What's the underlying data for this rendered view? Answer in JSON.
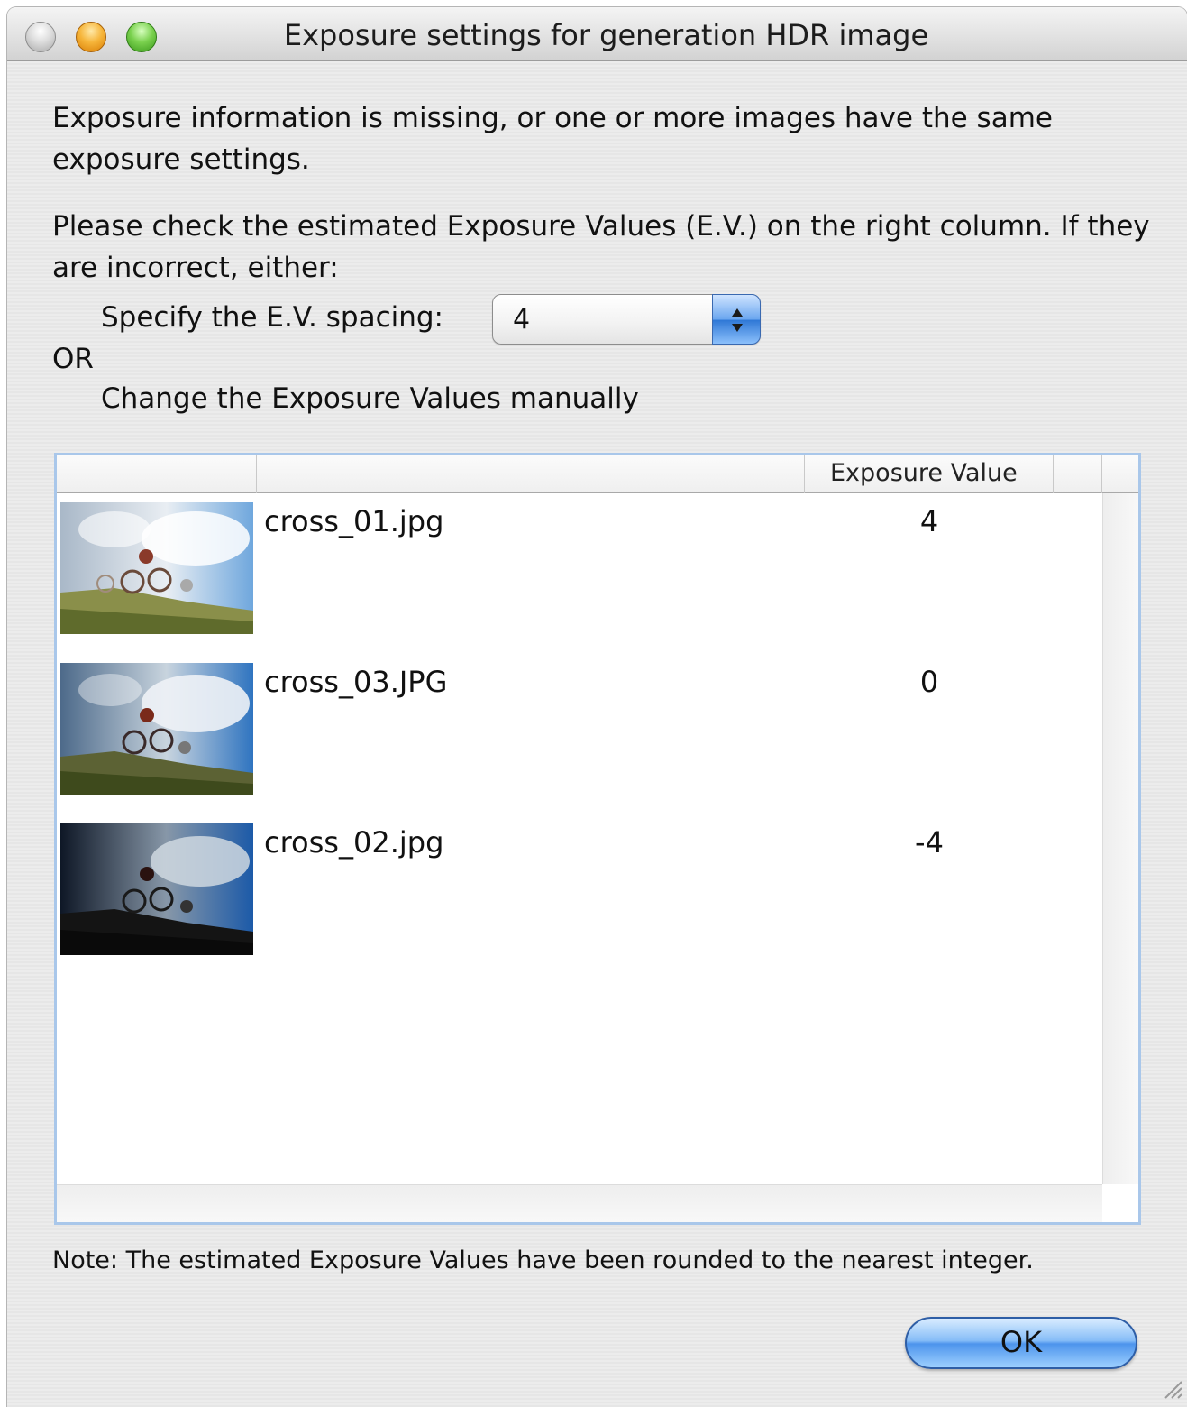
{
  "window": {
    "title": "Exposure settings for generation HDR image"
  },
  "intro": {
    "line1": "Exposure information is missing, or one or more images have the same exposure settings.",
    "line2": "Please check the estimated Exposure Values (E.V.) on the right column. If they are incorrect, either:"
  },
  "spacing": {
    "label": "Specify the E.V. spacing:",
    "selected_value": "4"
  },
  "or_label": "OR",
  "manual_label": "Change the Exposure Values manually",
  "table": {
    "headers": [
      "",
      "",
      "Exposure Value"
    ],
    "rows": [
      {
        "filename": "cross_01.jpg",
        "ev": "4"
      },
      {
        "filename": "cross_03.JPG",
        "ev": "0"
      },
      {
        "filename": "cross_02.jpg",
        "ev": "-4"
      }
    ]
  },
  "note": "Note: The estimated Exposure Values have been rounded to the nearest integer.",
  "buttons": {
    "ok_label": "OK"
  },
  "icons": {
    "close": "close-icon",
    "minimize": "minimize-icon",
    "zoom": "zoom-icon",
    "stepper": "up-down-arrows-icon",
    "resize": "resize-grip-icon"
  },
  "colors": {
    "accent_blue": "#4d94ec",
    "table_border": "#a9c7ea"
  }
}
